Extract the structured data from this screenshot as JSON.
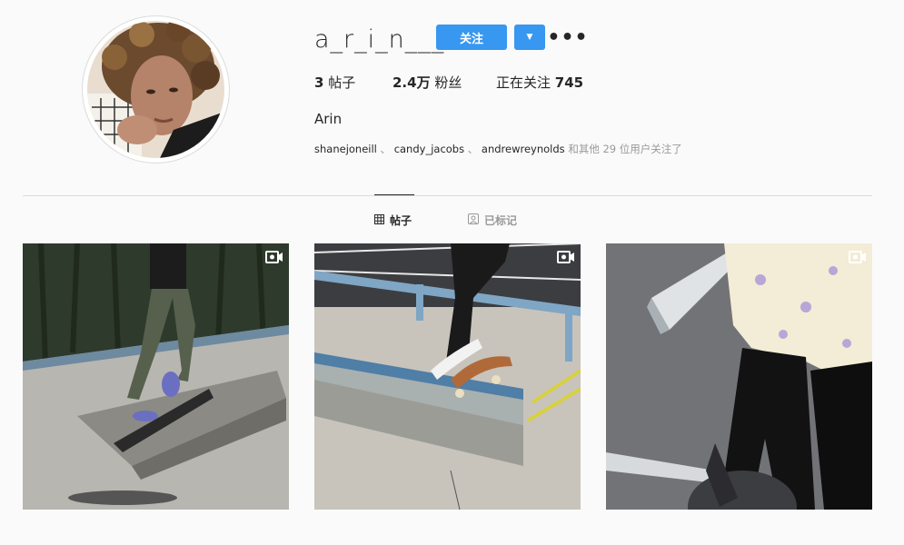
{
  "profile": {
    "username": "a_r_i_n___",
    "full_name": "Arin",
    "follow_label": "关注",
    "dropdown_icon": "chevron-down-icon",
    "more_icon": "more-options-icon"
  },
  "stats": {
    "posts_count": "3",
    "posts_label": " 帖子",
    "followers_count": "2.4万",
    "followers_label": " 粉丝",
    "following_label": "正在关注 ",
    "following_count": "745"
  },
  "followed_by": {
    "users": [
      "shanejoneill",
      "candy_jacobs",
      "andrewreynolds"
    ],
    "separator": "、",
    "suffix": " 和其他 29 位用户关注了"
  },
  "tabs": [
    {
      "label": "帖子",
      "icon": "grid-icon",
      "active": true
    },
    {
      "label": "已标记",
      "icon": "tagged-icon",
      "active": false
    }
  ],
  "posts": [
    {
      "type": "video",
      "icon": "video-icon",
      "description": "skater on concrete ledge"
    },
    {
      "type": "video",
      "icon": "video-icon",
      "description": "skateboard grinding ledge"
    },
    {
      "type": "video",
      "icon": "video-icon",
      "description": "person with skateboard near curb"
    }
  ],
  "colors": {
    "accent": "#3897f0",
    "background": "#fafafa",
    "text": "#262626",
    "muted": "#999999",
    "border": "#dbdbdb"
  }
}
